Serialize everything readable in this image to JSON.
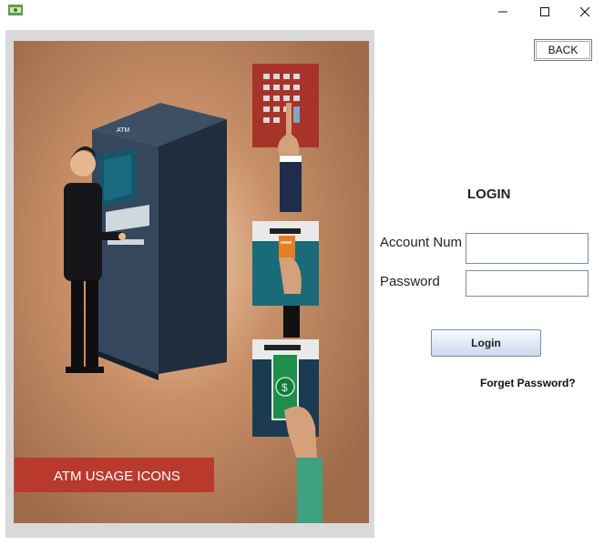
{
  "window": {
    "icons": [
      "app-icon",
      "minimize-icon",
      "maximize-icon",
      "close-icon"
    ]
  },
  "image": {
    "banner_text": "ATM USAGE ICONS",
    "atm_label": "ATM",
    "colors": {
      "background": "#b7845e",
      "banner": "#b83a2c",
      "atm_body": "#2c3b4c",
      "screen": "#14576a"
    }
  },
  "header": {
    "back_label": "BACK"
  },
  "login": {
    "title": "LOGIN",
    "account_label": "Account Num",
    "account_value": "",
    "password_label": "Password",
    "password_value": "",
    "login_button": "Login",
    "forget_link": "Forget Password?"
  }
}
